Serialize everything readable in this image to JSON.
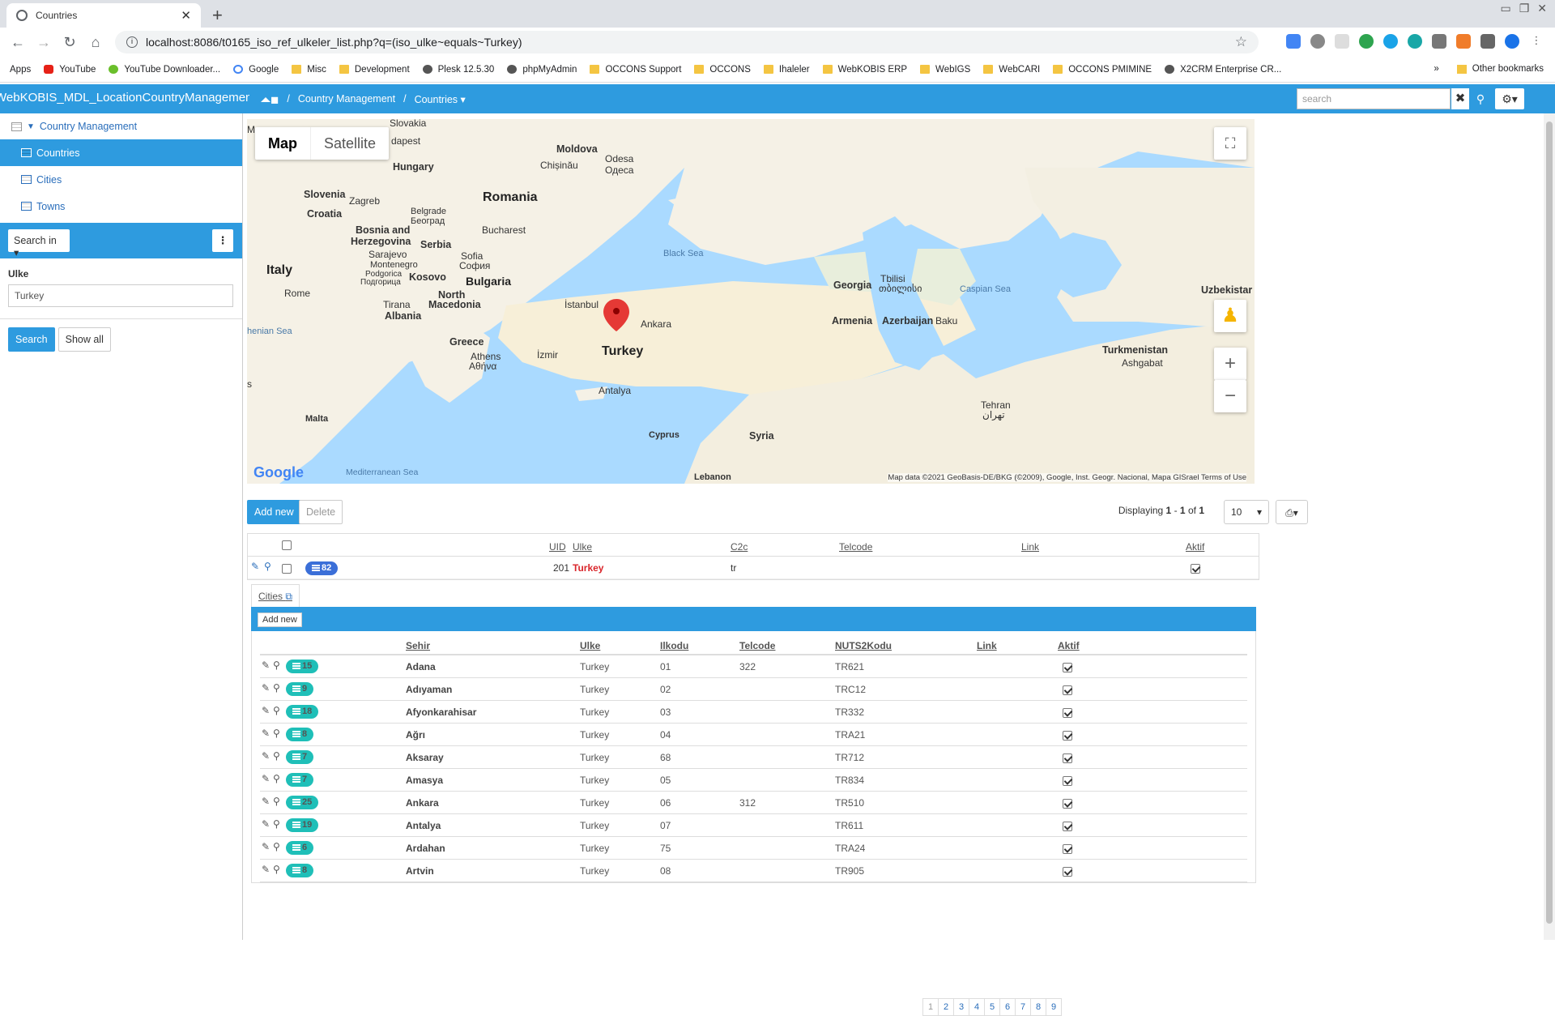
{
  "browser": {
    "tab_title": "Countries",
    "url": "localhost:8086/t0165_iso_ref_ulkeler_list.php?q=(iso_ulke~equals~Turkey)",
    "bookmarks": [
      "Apps",
      "YouTube",
      "YouTube Downloader...",
      "Google",
      "Misc",
      "Development",
      "Plesk 12.5.30",
      "phpMyAdmin",
      "OCCONS Support",
      "OCCONS",
      "Ihaleler",
      "WebKOBIS ERP",
      "WebIGS",
      "WebCARI",
      "OCCONS PMIMINE",
      "X2CRM Enterprise CR..."
    ],
    "more": "»",
    "other_bookmarks": "Other bookmarks"
  },
  "header": {
    "app_title": "WebKOBIS_MDL_LocationCountryManagement",
    "crumb_1": "Country Management",
    "crumb_sep": "/",
    "crumb_2": "Countries",
    "search_placeholder": "search"
  },
  "sidebar": {
    "group": "Country Management",
    "items": [
      {
        "label": "Countries"
      },
      {
        "label": "Cities"
      },
      {
        "label": "Towns"
      }
    ],
    "search_in": "Search in",
    "field_label": "Ulke",
    "field_value": "Turkey",
    "search_button": "Search",
    "show_all_button": "Show all"
  },
  "map": {
    "map_tab": "Map",
    "satellite_tab": "Satellite",
    "attribution": "Map data ©2021 GeoBasis-DE/BKG (©2009), Google, Inst. Geogr. Nacional, Mapa GISrael   Terms of Use",
    "google": "Google",
    "labels": {
      "slovakia": "Slovakia",
      "budapest": "dapest",
      "moldova": "Moldova",
      "odesa": "Odesa",
      "odesa2": "Одеса",
      "chisinau": "Chișinău",
      "hungary": "Hungary",
      "romania": "Romania",
      "slovenia": "Slovenia",
      "zagreb": "Zagreb",
      "croatia": "Croatia",
      "belgrade": "Belgrade",
      "beograd": "Београд",
      "bosnia": "Bosnia and",
      "herzegovina": "Herzegovina",
      "serbia": "Serbia",
      "bucharest": "Bucharest",
      "sarajevo": "Sarajevo",
      "montenegro": "Montenegro",
      "sofia": "Sofia",
      "sofia2": "София",
      "podgorica": "Podgorica",
      "podgorica2": "Подгорица",
      "kosovo": "Kosovo",
      "bulgaria": "Bulgaria",
      "black_sea": "Black Sea",
      "italy": "Italy",
      "rome": "Rome",
      "tirana": "Tirana",
      "albania": "Albania",
      "north": "North",
      "macedonia": "Macedonia",
      "istanbul": "İstanbul",
      "ankara": "Ankara",
      "georgia": "Georgia",
      "tbilisi": "Tbilisi",
      "tbilisi2": "თბილისი",
      "caspian": "Caspian Sea",
      "uzbek": "Uzbekistar",
      "ionian": "henian Sea",
      "greece": "Greece",
      "athens": "Athens",
      "athens2": "Αθήνα",
      "izmir": "İzmir",
      "turkey": "Turkey",
      "armenia": "Armenia",
      "azerbaijan": "Azerbaijan",
      "baku": "Baku",
      "turkmenistan": "Turkmenistan",
      "ashgabat": "Ashgabat",
      "antalya": "Antalya",
      "malta": "Malta",
      "cyprus": "Cyprus",
      "syria": "Syria",
      "tehran": "Tehran",
      "tehran2": "تهران",
      "med_sea": "Mediterranean Sea",
      "lebanon": "Lebanon",
      "m": "M",
      "s": "s"
    }
  },
  "grid": {
    "add_new": "Add new",
    "delete": "Delete",
    "displaying_prefix": "Displaying",
    "disp_from": "1",
    "disp_dash": "-",
    "disp_to": "1",
    "disp_of": "of",
    "disp_total": "1",
    "page_size": "10",
    "columns": [
      "UID",
      "Ulke",
      "C2c",
      "Telcode",
      "Link",
      "Aktif"
    ],
    "row": {
      "badge": "82",
      "uid": "201",
      "ulke": "Turkey",
      "c2c": "tr",
      "telcode": "",
      "link": "",
      "aktif": true
    }
  },
  "detail": {
    "tab_label": "Cities",
    "add_new": "Add new",
    "columns": [
      "Sehir",
      "Ulke",
      "Ilkodu",
      "Telcode",
      "NUTS2Kodu",
      "Link",
      "Aktif"
    ],
    "rows": [
      {
        "badge": "15",
        "sehir": "Adana",
        "ulke": "Turkey",
        "ilkodu": "01",
        "telcode": "322",
        "nuts": "TR621",
        "link": ""
      },
      {
        "badge": "9",
        "sehir": "Adıyaman",
        "ulke": "Turkey",
        "ilkodu": "02",
        "telcode": "",
        "nuts": "TRC12",
        "link": ""
      },
      {
        "badge": "18",
        "sehir": "Afyonkarahisar",
        "ulke": "Turkey",
        "ilkodu": "03",
        "telcode": "",
        "nuts": "TR332",
        "link": ""
      },
      {
        "badge": "8",
        "sehir": "Ağrı",
        "ulke": "Turkey",
        "ilkodu": "04",
        "telcode": "",
        "nuts": "TRA21",
        "link": ""
      },
      {
        "badge": "7",
        "sehir": "Aksaray",
        "ulke": "Turkey",
        "ilkodu": "68",
        "telcode": "",
        "nuts": "TR712",
        "link": ""
      },
      {
        "badge": "7",
        "sehir": "Amasya",
        "ulke": "Turkey",
        "ilkodu": "05",
        "telcode": "",
        "nuts": "TR834",
        "link": ""
      },
      {
        "badge": "25",
        "sehir": "Ankara",
        "ulke": "Turkey",
        "ilkodu": "06",
        "telcode": "312",
        "nuts": "TR510",
        "link": ""
      },
      {
        "badge": "19",
        "sehir": "Antalya",
        "ulke": "Turkey",
        "ilkodu": "07",
        "telcode": "",
        "nuts": "TR611",
        "link": ""
      },
      {
        "badge": "6",
        "sehir": "Ardahan",
        "ulke": "Turkey",
        "ilkodu": "75",
        "telcode": "",
        "nuts": "TRA24",
        "link": ""
      },
      {
        "badge": "8",
        "sehir": "Artvin",
        "ulke": "Turkey",
        "ilkodu": "08",
        "telcode": "",
        "nuts": "TR905",
        "link": ""
      }
    ],
    "pages": [
      "1",
      "2",
      "3",
      "4",
      "5",
      "6",
      "7",
      "8",
      "9"
    ]
  },
  "colors": {
    "accent": "#2e9bdf",
    "badge_blue": "#3b6fd8",
    "badge_teal": "#1fbfb8",
    "map_water": "#aadaff",
    "map_land": "#f5f1e6",
    "marker": "#e53935"
  }
}
